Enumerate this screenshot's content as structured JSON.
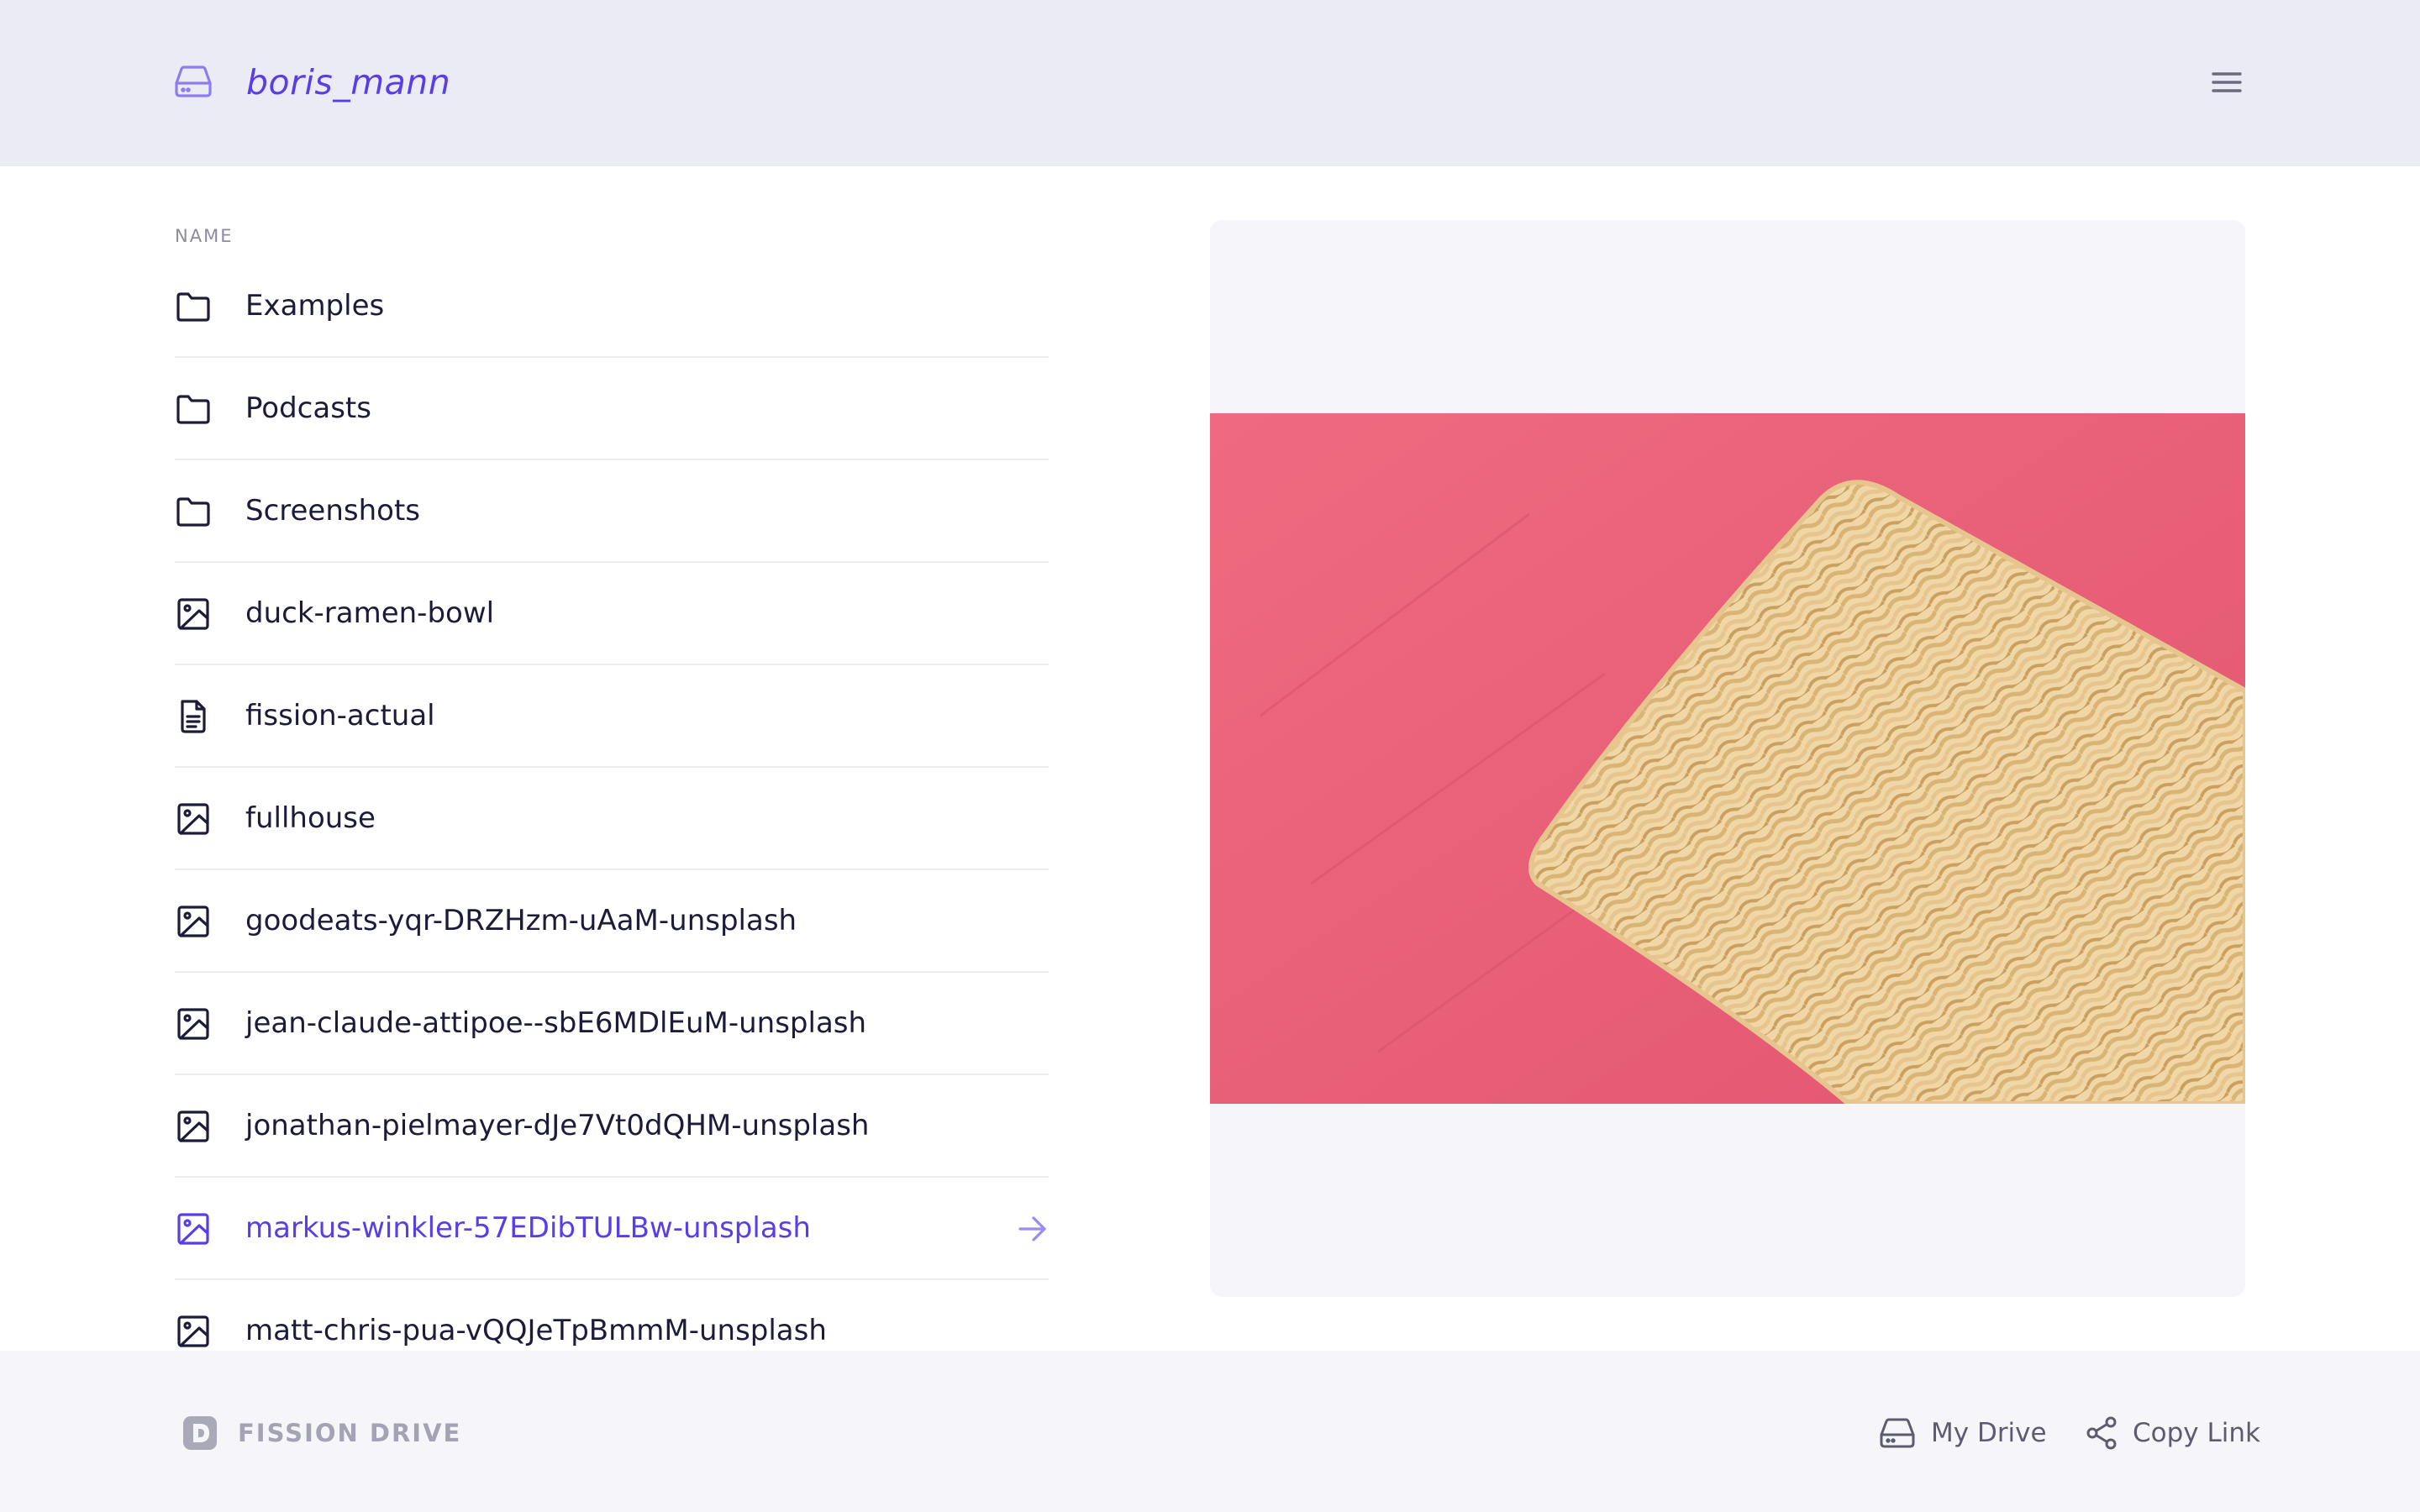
{
  "header": {
    "username": "boris_mann",
    "drive_icon": "hard-drive-icon",
    "menu_icon": "hamburger-menu-icon",
    "accent_color": "#5b3de8",
    "background_color": "#ebebf5"
  },
  "file_list": {
    "column_header": "NAME",
    "items": [
      {
        "name": "Examples",
        "icon": "folder-icon",
        "selected": false
      },
      {
        "name": "Podcasts",
        "icon": "folder-icon",
        "selected": false
      },
      {
        "name": "Screenshots",
        "icon": "folder-icon",
        "selected": false
      },
      {
        "name": "duck-ramen-bowl",
        "icon": "image-icon",
        "selected": false
      },
      {
        "name": "fission-actual",
        "icon": "document-icon",
        "selected": false
      },
      {
        "name": "fullhouse",
        "icon": "image-icon",
        "selected": false
      },
      {
        "name": "goodeats-yqr-DRZHzm-uAaM-unsplash",
        "icon": "image-icon",
        "selected": false
      },
      {
        "name": "jean-claude-attipoe--sbE6MDlEuM-unsplash",
        "icon": "image-icon",
        "selected": false
      },
      {
        "name": "jonathan-pielmayer-dJe7Vt0dQHM-unsplash",
        "icon": "image-icon",
        "selected": false
      },
      {
        "name": "markus-winkler-57EDibTULBw-unsplash",
        "icon": "image-icon",
        "selected": true
      },
      {
        "name": "matt-chris-pua-vQQJeTpBmmM-unsplash",
        "icon": "image-icon",
        "selected": false
      }
    ],
    "selected_arrow_icon": "arrow-right-icon"
  },
  "preview": {
    "image_icon": "ramen-noodles-image",
    "image_background_color": "#ea5d74",
    "panel_color": "#f5f5fa"
  },
  "footer": {
    "brand_logo": "fission-logo-icon",
    "brand_name": "FISSION DRIVE",
    "my_drive": {
      "label": "My Drive",
      "icon": "hard-drive-icon"
    },
    "copy_link": {
      "label": "Copy Link",
      "icon": "share-icon"
    }
  }
}
